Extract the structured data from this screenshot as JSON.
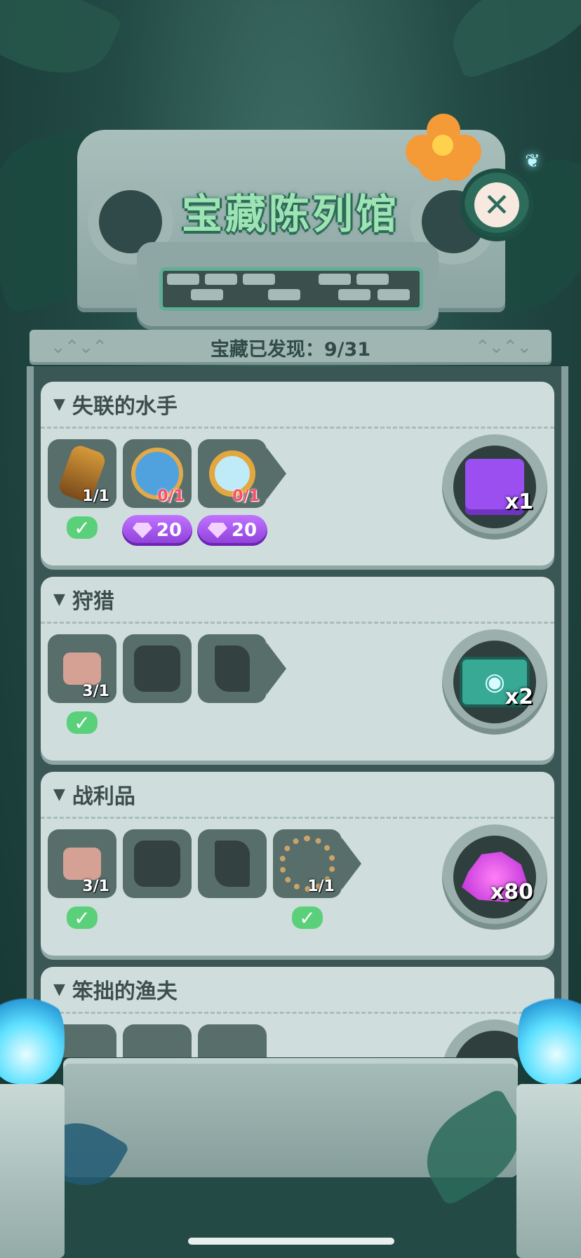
{
  "header": {
    "title": "宝藏陈列馆",
    "close_icon": "close-icon"
  },
  "progress": {
    "label": "宝藏已发现：9/31",
    "found": 9,
    "total": 31
  },
  "collections": [
    {
      "title": "失联的水手",
      "items": [
        {
          "icon": "telescope-icon",
          "count": "1/1",
          "collected": true
        },
        {
          "icon": "compass-icon",
          "count": "0/1",
          "collected": false,
          "gem_cost": "20"
        },
        {
          "icon": "magnifier-icon",
          "count": "0/1",
          "collected": false,
          "gem_cost": "20"
        }
      ],
      "reward": {
        "icon": "gift-box-icon",
        "qty": "x1"
      }
    },
    {
      "title": "狩猎",
      "items": [
        {
          "icon": "hammer-icon",
          "count": "3/1",
          "collected": true
        },
        {
          "icon": "locked-silhouette-icon"
        },
        {
          "icon": "locked-silhouette-icon"
        }
      ],
      "reward": {
        "icon": "eye-ticket-icon",
        "qty": "x2"
      }
    },
    {
      "title": "战利品",
      "items": [
        {
          "icon": "hammer-icon",
          "count": "3/1",
          "collected": true
        },
        {
          "icon": "locked-silhouette-icon"
        },
        {
          "icon": "locked-silhouette-icon"
        },
        {
          "icon": "bracelet-icon",
          "count": "1/1",
          "collected": true
        }
      ],
      "reward": {
        "icon": "gems-icon",
        "qty": "x80"
      }
    },
    {
      "title": "笨拙的渔夫",
      "reward": {
        "icon": "coins-icon"
      }
    }
  ],
  "colors": {
    "accent_green": "#5bd07a",
    "gem_purple": "#a255ec",
    "title_green": "#9ee3b4"
  }
}
